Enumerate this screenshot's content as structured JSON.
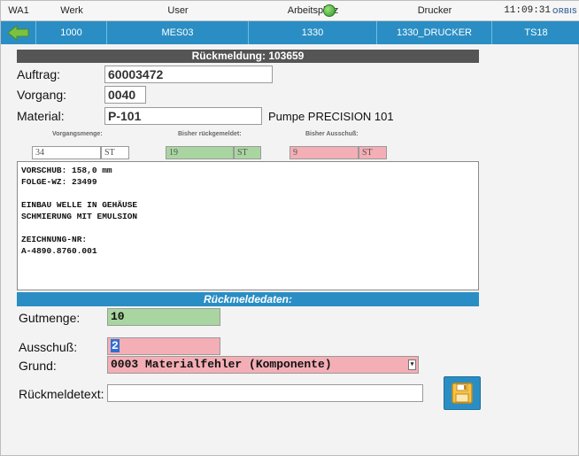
{
  "header": {
    "station": "WA1",
    "col_werk": "Werk",
    "col_user": "User",
    "col_arbeitsplatz": "Arbeitsplatz",
    "col_drucker": "Drucker",
    "clock": "11:09:31",
    "logo_text": "ORBIS"
  },
  "bar": {
    "werk": "1000",
    "user": "MES03",
    "arbeitsplatz": "1330",
    "drucker": "1330_DRUCKER",
    "station_code": "TS18"
  },
  "title": "Rückmeldung: 103659",
  "order": {
    "auftrag_label": "Auftrag:",
    "auftrag_value": "60003472",
    "vorgang_label": "Vorgang:",
    "vorgang_value": "0040",
    "material_label": "Material:",
    "material_value": "P-101",
    "material_desc": "Pumpe PRECISION 101"
  },
  "quantities": {
    "vorgangsmenge_label": "Vorgangsmenge:",
    "vorgangsmenge_value": "34",
    "vorgangsmenge_unit": "ST",
    "bisher_label": "Bisher rückgemeldet:",
    "bisher_value": "19",
    "bisher_unit": "ST",
    "ausschuss_label": "Bisher Ausschuß:",
    "ausschuss_value": "9",
    "ausschuss_unit": "ST"
  },
  "operation_text": "VORSCHUB: 158,0 mm\nFOLGE-WZ: 23499\n\nEINBAU WELLE IN GEHÄUSE\nSCHMIERUNG MIT EMULSION\n\nZEICHNUNG-NR:\nA-4890.8760.001",
  "section_title": "Rückmeldedaten:",
  "form": {
    "gutmenge_label": "Gutmenge:",
    "gutmenge_value": "10",
    "ausschuss_label": "Ausschuß:",
    "ausschuss_value": "2",
    "grund_label": "Grund:",
    "grund_value": "0003 Materialfehler (Komponente)",
    "text_label": "Rückmeldetext:",
    "text_value": ""
  },
  "colors": {
    "accent_blue": "#2a8ec4",
    "good_green": "#a9d6a0",
    "scrap_pink": "#f4aeb5",
    "title_gray": "#555555"
  },
  "icons": {
    "back": "arrow-left-icon",
    "status": "status-ok-icon",
    "save": "floppy-disk-icon"
  }
}
